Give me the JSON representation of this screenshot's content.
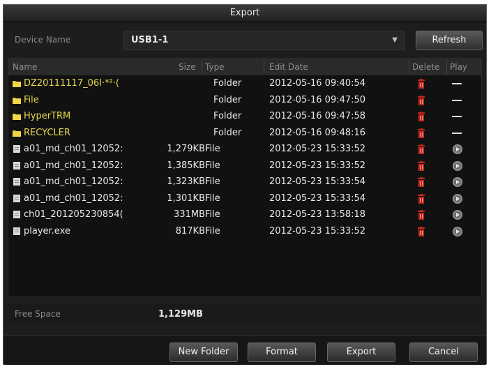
{
  "dialog": {
    "title": "Export"
  },
  "device": {
    "label": "Device Name",
    "selected": "USB1-1",
    "refresh_label": "Refresh"
  },
  "columns": {
    "name": "Name",
    "size": "Size",
    "type": "Type",
    "edit_date": "Edit Date",
    "delete": "Delete",
    "play": "Play"
  },
  "files": [
    {
      "name": "DZ20111117_06Ì·*²·(",
      "size": "",
      "type": "Folder",
      "date": "2012-05-16 09:40:54",
      "kind": "folder"
    },
    {
      "name": "File",
      "size": "",
      "type": "Folder",
      "date": "2012-05-16 09:47:50",
      "kind": "folder"
    },
    {
      "name": "HyperTRM",
      "size": "",
      "type": "Folder",
      "date": "2012-05-16 09:47:58",
      "kind": "folder"
    },
    {
      "name": "RECYCLER",
      "size": "",
      "type": "Folder",
      "date": "2012-05-16 09:48:16",
      "kind": "folder"
    },
    {
      "name": "a01_md_ch01_12052:",
      "size": "1,279KB",
      "type": "File",
      "date": "2012-05-23 15:33:52",
      "kind": "file"
    },
    {
      "name": "a01_md_ch01_12052:",
      "size": "1,385KB",
      "type": "File",
      "date": "2012-05-23 15:33:52",
      "kind": "file"
    },
    {
      "name": "a01_md_ch01_12052:",
      "size": "1,323KB",
      "type": "File",
      "date": "2012-05-23 15:33:54",
      "kind": "file"
    },
    {
      "name": "a01_md_ch01_12052:",
      "size": "1,301KB",
      "type": "File",
      "date": "2012-05-23 15:33:54",
      "kind": "file"
    },
    {
      "name": "ch01_201205230854(",
      "size": "331MB",
      "type": "File",
      "date": "2012-05-23 13:58:18",
      "kind": "file"
    },
    {
      "name": "player.exe",
      "size": "817KB",
      "type": "File",
      "date": "2012-05-23 15:33:52",
      "kind": "file"
    }
  ],
  "free_space": {
    "label": "Free Space",
    "value": "1,129MB"
  },
  "buttons": {
    "new_folder": "New Folder",
    "format": "Format",
    "export": "Export",
    "cancel": "Cancel"
  },
  "colors": {
    "folder_name": "#e8d84e",
    "delete_icon": "#c0281e"
  },
  "icons": {
    "folder": "folder-icon",
    "file": "file-icon",
    "delete": "trash-icon",
    "play": "play-icon",
    "dropdown": "chevron-down-icon"
  }
}
